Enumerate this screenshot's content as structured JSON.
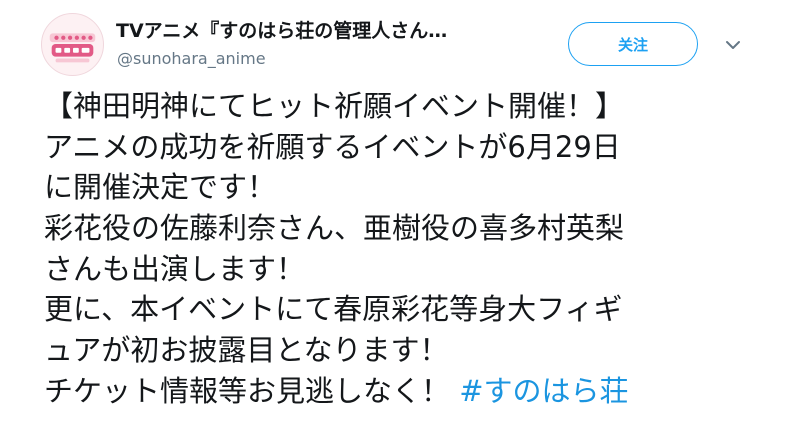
{
  "tweet": {
    "author_name": "TVアニメ『すのはら荘の管理人さん…",
    "author_handle": "@sunohara_anime",
    "avatar_logo_text": "すのはら荘の管理人さん",
    "follow_label": "关注",
    "caret_icon": "chevron-down-icon",
    "lines": [
      "【神田明神にてヒット祈願イベント開催！】",
      "アニメの成功を祈願するイベントが6月29日",
      "に開催決定です！",
      "彩花役の佐藤利奈さん、亜樹役の喜多村英梨",
      "さんも出演します！",
      "更に、本イベントにて春原彩花等身大フィギ",
      "ュアが初お披露目となります！"
    ],
    "last_line_text": "チケット情報等お見逃しなく！ ",
    "hashtag": "#すのはら荘",
    "colors": {
      "accent": "#1da1f2",
      "hashtag": "#1b95e0",
      "text": "#14171a",
      "secondary": "#657786",
      "avatar_pink": "#e25a86"
    }
  }
}
